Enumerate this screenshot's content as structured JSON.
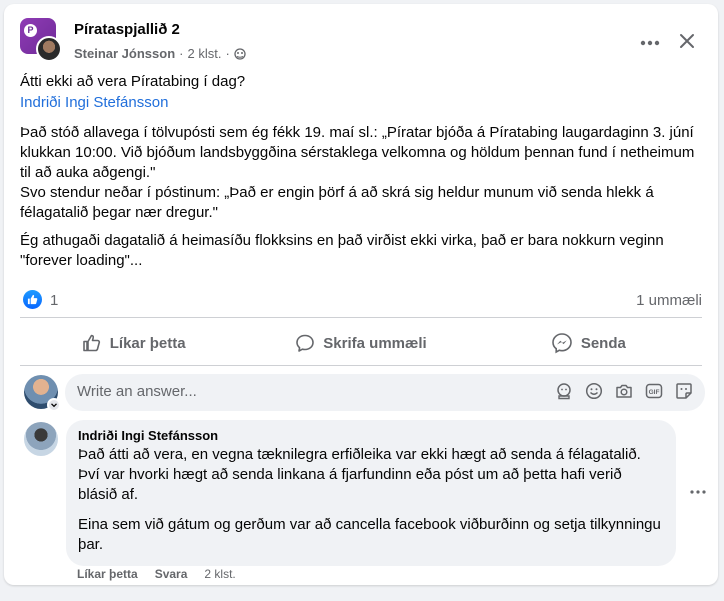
{
  "post": {
    "group_name": "Pírataspjallið 2",
    "group_avatar_letter": "P",
    "author": "Steinar Jónsson",
    "time": "2 klst.",
    "separator": "·",
    "text": {
      "line1": "Átti ekki að vera Píratabing í dag?",
      "mention": "Indriði Ingi Stefánsson",
      "para1": "Það stóð allavega í tölvupósti sem ég fékk 19. maí sl.: „Píratar bjóða á Píratabing laugardaginn 3. júní klukkan 10:00. Við bjóðum landsbyggðina sérstaklega velkomna og höldum þennan fund í netheimum til að auka aðgengi.\"",
      "para2": "Svo stendur neðar í póstinum: „Það er engin þörf á að skrá sig heldur munum við senda hlekk á félagatalið þegar nær dregur.\"",
      "para3": "Ég athugaði dagatalið á heimasíðu flokksins en það virðist ekki virka, það er bara nokkurn veginn \"forever loading\"..."
    }
  },
  "reactions": {
    "like_count": "1",
    "comment_count": "1 ummæli"
  },
  "actions": {
    "like": "Líkar þetta",
    "comment": "Skrifa ummæli",
    "share": "Senda"
  },
  "answer": {
    "placeholder": "Write an answer..."
  },
  "comment": {
    "author": "Indriði Ingi Stefánsson",
    "para1": "Það átti að vera, en vegna tæknilegra erfiðleika var ekki hægt að senda á félagatalið. Því var hvorki hægt að senda linkana á fjarfundinn eða póst um að þetta hafi verið blásið af.",
    "para2": "Eina sem við gátum og gerðum var að cancella facebook viðburðinn og setja tilkynningu þar.",
    "like_label": "Líkar þetta",
    "reply_label": "Svara",
    "time": "2 klst."
  },
  "colors": {
    "link": "#216fdb",
    "secondary_text": "#65676b",
    "like_blue": "#0866ff",
    "group_purple": "#7b32a8"
  }
}
